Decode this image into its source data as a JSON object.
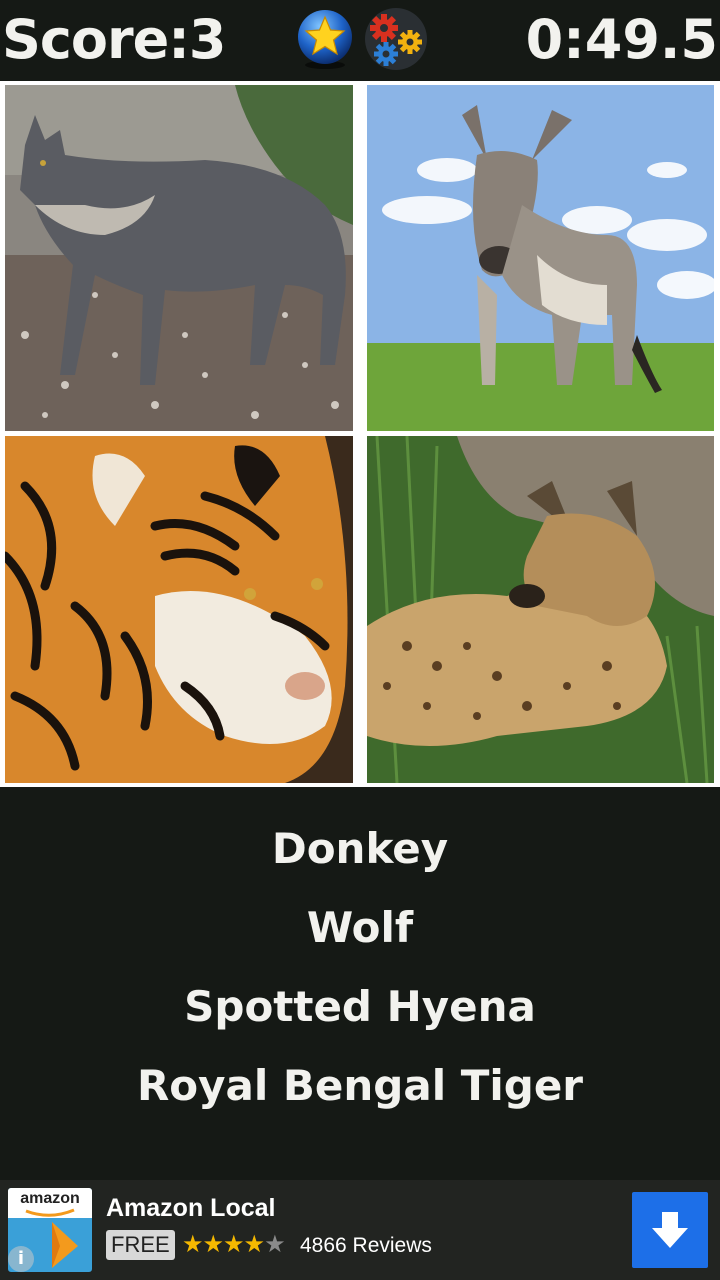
{
  "header": {
    "score_text": "Score:3",
    "timer_text": "0:49.5",
    "rate_icon": "star-icon",
    "settings_icon": "gears-icon"
  },
  "tiles": [
    {
      "animal_image": "wolf"
    },
    {
      "animal_image": "donkey"
    },
    {
      "animal_image": "tiger"
    },
    {
      "animal_image": "spotted-hyena"
    }
  ],
  "answers": [
    "Donkey",
    "Wolf",
    "Spotted Hyena",
    "Royal Bengal Tiger"
  ],
  "ad": {
    "logo_text": "amazon",
    "title": "Amazon Local",
    "badge": "FREE",
    "rating": 4.5,
    "reviews": "4866 Reviews",
    "download_icon": "download-arrow-icon",
    "info_icon": "info-icon"
  },
  "colors": {
    "background": "#151915",
    "grid_border": "#ffffff",
    "text": "#f2f2ee",
    "ad_button": "#1d6fe8",
    "star": "#f5b800"
  }
}
